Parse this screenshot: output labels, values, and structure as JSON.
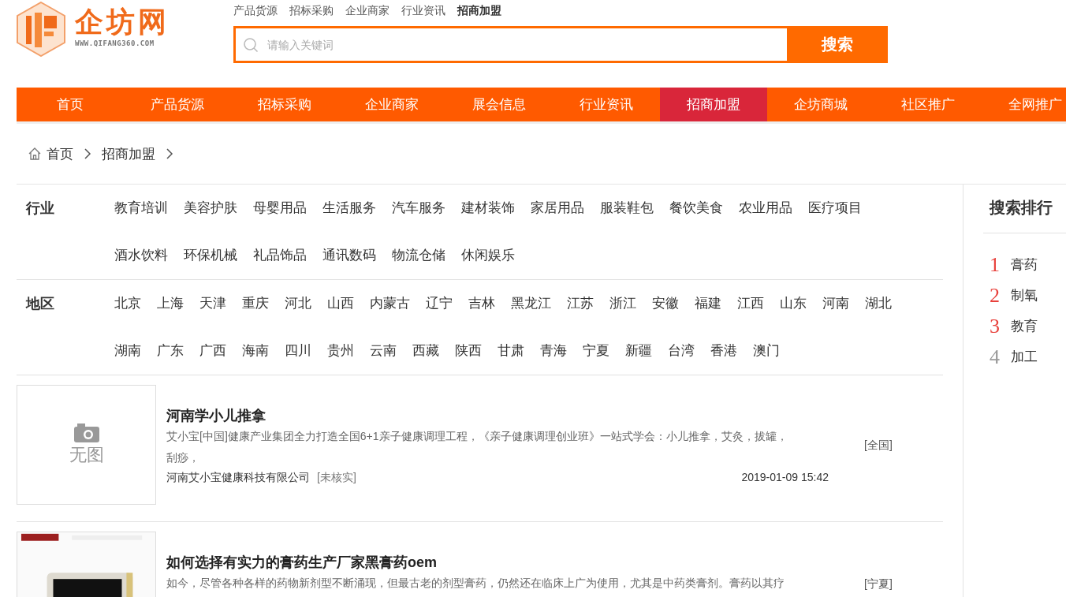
{
  "logo": {
    "name": "企坊网",
    "url": "WWW.QIFANG360.COM"
  },
  "top_links": [
    {
      "label": "产品货源",
      "selected": false
    },
    {
      "label": "招标采购",
      "selected": false
    },
    {
      "label": "企业商家",
      "selected": false
    },
    {
      "label": "行业资讯",
      "selected": false
    },
    {
      "label": "招商加盟",
      "selected": true
    }
  ],
  "search": {
    "placeholder": "请输入关键词",
    "button": "搜索"
  },
  "nav": [
    {
      "label": "首页",
      "selected": false
    },
    {
      "label": "产品货源",
      "selected": false
    },
    {
      "label": "招标采购",
      "selected": false
    },
    {
      "label": "企业商家",
      "selected": false
    },
    {
      "label": "展会信息",
      "selected": false
    },
    {
      "label": "行业资讯",
      "selected": false
    },
    {
      "label": "招商加盟",
      "selected": true
    },
    {
      "label": "企坊商城",
      "selected": false
    },
    {
      "label": "社区推广",
      "selected": false
    },
    {
      "label": "全网推广",
      "selected": false
    }
  ],
  "breadcrumb": [
    "首页",
    "招商加盟"
  ],
  "filters": [
    {
      "label": "行业",
      "options": [
        "教育培训",
        "美容护肤",
        "母婴用品",
        "生活服务",
        "汽车服务",
        "建材装饰",
        "家居用品",
        "服装鞋包",
        "餐饮美食",
        "农业用品",
        "医疗项目",
        "酒水饮料",
        "环保机械",
        "礼品饰品",
        "通讯数码",
        "物流仓储",
        "休闲娱乐"
      ]
    },
    {
      "label": "地区",
      "options": [
        "北京",
        "上海",
        "天津",
        "重庆",
        "河北",
        "山西",
        "内蒙古",
        "辽宁",
        "吉林",
        "黑龙江",
        "江苏",
        "浙江",
        "安徽",
        "福建",
        "江西",
        "山东",
        "河南",
        "湖北",
        "湖南",
        "广东",
        "广西",
        "海南",
        "四川",
        "贵州",
        "云南",
        "西藏",
        "陕西",
        "甘肃",
        "青海",
        "宁夏",
        "新疆",
        "台湾",
        "香港",
        "澳门"
      ]
    }
  ],
  "listings": [
    {
      "kind": "no-image",
      "no_image_label": "无图",
      "title": "河南学小儿推拿",
      "description": "艾小宝[中国]健康产业集团全力打造全国6+1亲子健康调理工程，《亲子健康调理创业班》一站式学会：小儿推拿，艾灸，拔罐，刮痧，",
      "company": "河南艾小宝健康科技有限公司",
      "verification": "[未核实]",
      "date": "2019-01-09 15:42",
      "region": "[全国]"
    },
    {
      "kind": "picture",
      "title": "如何选择有实力的膏药生产厂家黑膏药oem",
      "description": "如今，尽管各种各样的药物新剂型不断涌现，但最古老的剂型膏药，仍然还在临床上广为使用，尤其是中药类膏剂。膏药以其疗",
      "region": "[宁夏]"
    }
  ],
  "ranking": {
    "title": "搜索排行",
    "items": [
      {
        "rank": "1",
        "term": "膏药",
        "color": "#e8413c"
      },
      {
        "rank": "2",
        "term": "制氧",
        "color": "#e8413c"
      },
      {
        "rank": "3",
        "term": "教育",
        "color": "#e8413c"
      },
      {
        "rank": "4",
        "term": "加工",
        "color": "#999999"
      }
    ]
  }
}
